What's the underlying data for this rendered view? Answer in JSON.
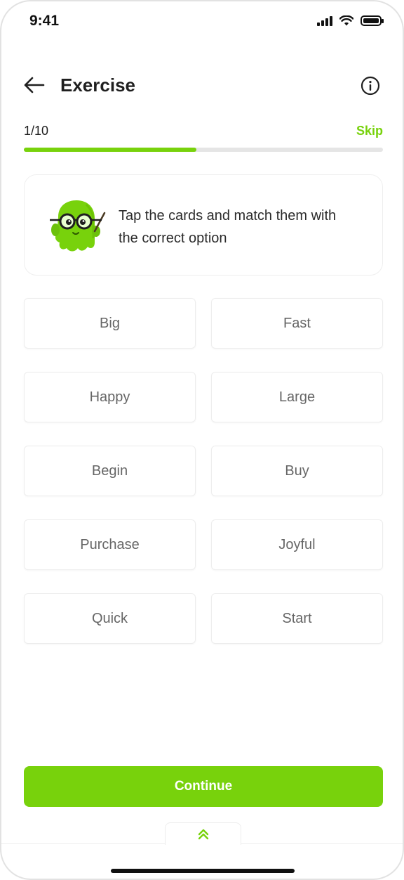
{
  "status_bar": {
    "time": "9:41"
  },
  "header": {
    "title": "Exercise"
  },
  "progress": {
    "count_label": "1/10",
    "skip_label": "Skip",
    "fraction": 0.48
  },
  "instruction": {
    "text": "Tap the cards and match them with the correct option"
  },
  "cards": [
    {
      "label": "Big"
    },
    {
      "label": "Fast"
    },
    {
      "label": "Happy"
    },
    {
      "label": "Large"
    },
    {
      "label": "Begin"
    },
    {
      "label": "Buy"
    },
    {
      "label": "Purchase"
    },
    {
      "label": "Joyful"
    },
    {
      "label": "Quick"
    },
    {
      "label": "Start"
    }
  ],
  "continue": {
    "label": "Continue"
  },
  "icons": {
    "back": "arrow-left-icon",
    "info": "info-circle-icon",
    "expand": "double-chevron-up-icon",
    "mascot": "mascot-teacher-illustration"
  },
  "colors": {
    "accent": "#78d20c",
    "track": "#e5e5e5",
    "card_border": "#ededed"
  }
}
